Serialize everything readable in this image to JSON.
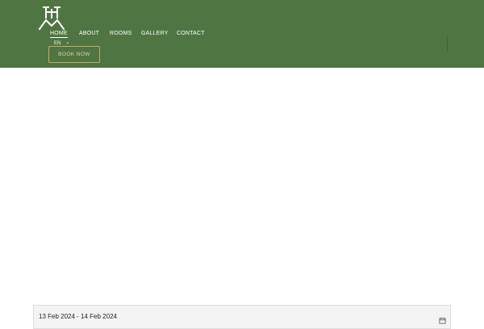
{
  "colors": {
    "header_bg": "#4f7542",
    "accent_gold": "#c9a86a",
    "nav_text": "#ffffff",
    "date_bar_bg": "#f4f4f4"
  },
  "header": {
    "logo_icon": "castle-mountain-logo",
    "nav": [
      {
        "label": "HOME",
        "active": true
      },
      {
        "label": "ABOUT",
        "active": false
      },
      {
        "label": "ROOMS",
        "active": false
      },
      {
        "label": "GALLERY",
        "active": false
      },
      {
        "label": "CONTACT",
        "active": false
      }
    ],
    "language": {
      "selected": "EN",
      "icon": "chevron-down-icon"
    },
    "book_button": "BOOK NOW"
  },
  "booking": {
    "date_range": "13 Feb 2024 - 14 Feb 2024",
    "icon": "calendar-icon"
  }
}
